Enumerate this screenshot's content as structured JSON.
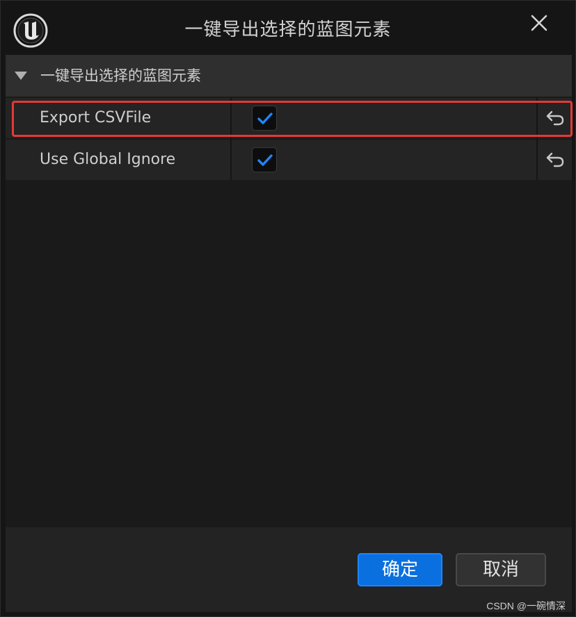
{
  "window": {
    "title": "一键导出选择的蓝图元素",
    "logo_icon": "unreal-engine-logo",
    "close_icon": "close-icon"
  },
  "category": {
    "label": "一键导出选择的蓝图元素",
    "expanded": true,
    "arrow_icon": "triangle-down-icon"
  },
  "properties": [
    {
      "name": "Export CSVFile",
      "checked": true,
      "reset_icon": "reset-to-default-icon",
      "highlighted": true
    },
    {
      "name": "Use Global Ignore",
      "checked": true,
      "reset_icon": "reset-to-default-icon",
      "highlighted": false
    }
  ],
  "footer": {
    "ok_label": "确定",
    "cancel_label": "取消"
  },
  "watermark": "CSDN @一碗情深",
  "colors": {
    "accent": "#0a70e0",
    "checkmark": "#1e86ff",
    "highlight_box": "#e53935"
  }
}
